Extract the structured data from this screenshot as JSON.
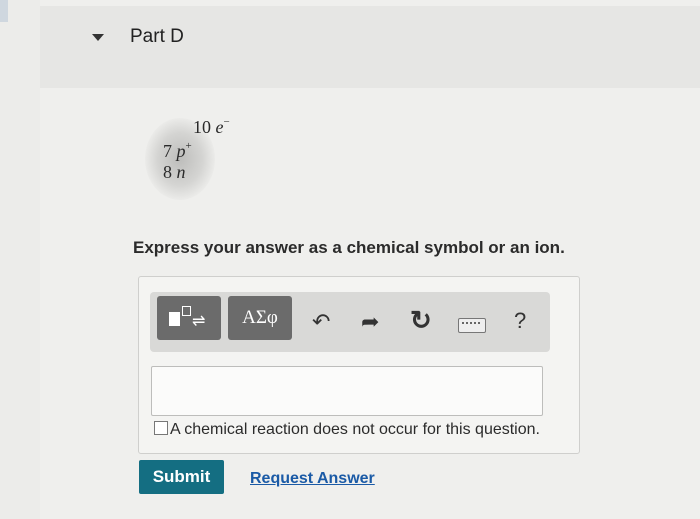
{
  "part": {
    "title": "Part D"
  },
  "atom": {
    "electrons": "10",
    "electron_symbol": "e",
    "electron_sup": "−",
    "protons": "7",
    "proton_symbol": "p",
    "proton_sup": "+",
    "neutrons": "8",
    "neutron_symbol": "n"
  },
  "prompt": "Express your answer as a chemical symbol or an ion.",
  "toolbar": {
    "greek_label": "ΑΣφ",
    "undo_glyph": "↶",
    "redo_glyph": "➦",
    "reset_glyph": "↻",
    "help_label": "?",
    "icons": [
      "templates-icon",
      "greek-letters",
      "undo-icon",
      "redo-icon",
      "reset-icon",
      "keyboard-icon",
      "help-icon"
    ]
  },
  "answer": {
    "value": ""
  },
  "no_reaction": {
    "label": "A chemical reaction does not occur for this question.",
    "checked": false
  },
  "actions": {
    "submit_label": "Submit",
    "request_label": "Request Answer"
  },
  "colors": {
    "submit": "#146e82",
    "link": "#1a5aa6",
    "toolbar_dark": "#6b6b6b"
  }
}
